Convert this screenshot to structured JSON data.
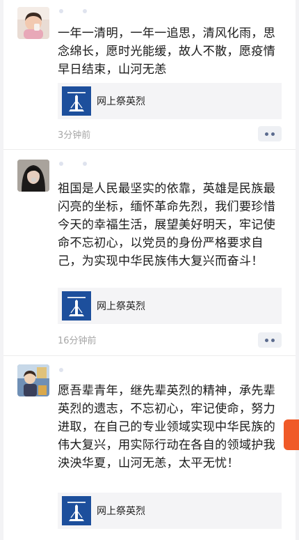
{
  "posts": [
    {
      "content": "一年一清明，一年一追思，清风化雨，思念绵长，愿时光能缓，故人不散，愿疫情早日结束，山河无恙",
      "link_title": "网上祭英烈",
      "time": "3分钟前"
    },
    {
      "content": "祖国是人民最坚实的依靠，英雄是民族最闪亮的坐标，缅怀革命先烈，我们要珍惜今天的幸福生活，展望美好明天，牢记使命不忘初心，以党员的身份严格要求自己，为实现中华民族伟大复兴而奋斗！",
      "link_title": "网上祭英烈",
      "time": "16分钟前"
    },
    {
      "content": "愿吾辈青年，继先辈英烈的精神，承先辈英烈的遗志，不忘初心，牢记使命，努力进取，在自己的专业领域实现中华民族的伟大复兴，用实际行动在各自的领域护我泱泱华夏，山河无恙，太平无忧！",
      "link_title": "网上祭英烈"
    }
  ],
  "icons": {
    "more": "more-dots-icon",
    "link_logo": "memorial-logo-icon",
    "float": "float-tab-icon"
  },
  "colors": {
    "text": "#1a1a1a",
    "time": "#a6a6a6",
    "logo_blue": "#1d4f9c",
    "more_dots": "#5b6b8e",
    "float_tab": "#f05a28"
  }
}
